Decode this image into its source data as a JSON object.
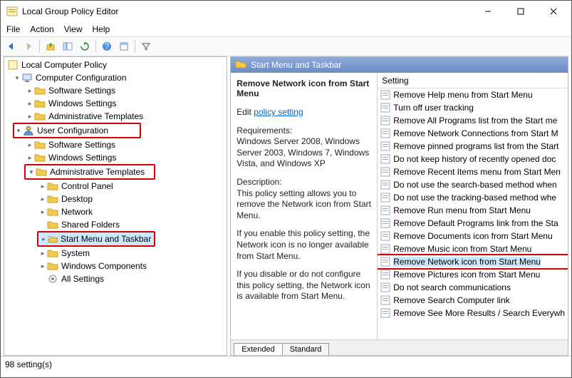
{
  "window": {
    "title": "Local Group Policy Editor"
  },
  "menu": {
    "file": "File",
    "action": "Action",
    "view": "View",
    "help": "Help"
  },
  "tree": {
    "root": "Local Computer Policy",
    "computer": "Computer Configuration",
    "cc_software": "Software Settings",
    "cc_windows": "Windows Settings",
    "cc_admin": "Administrative Templates",
    "user": "User Configuration",
    "uc_software": "Software Settings",
    "uc_windows": "Windows Settings",
    "uc_admin": "Administrative Templates",
    "control_panel": "Control Panel",
    "desktop": "Desktop",
    "network": "Network",
    "shared": "Shared Folders",
    "start": "Start Menu and Taskbar",
    "system": "System",
    "wincomp": "Windows Components",
    "allset": "All Settings"
  },
  "rp": {
    "header": "Start Menu and Taskbar",
    "title": "Remove Network icon from Start Menu",
    "edit_prefix": "Edit",
    "edit_link": "policy setting",
    "req_label": "Requirements:",
    "req_text": "Windows Server 2008, Windows Server 2003, Windows 7, Windows Vista, and Windows XP",
    "desc_label": "Description:",
    "desc_text": "This policy setting allows you to remove the Network icon from Start Menu.",
    "enable_text": "If you enable this policy setting, the Network icon is no longer available from Start Menu.",
    "disable_text": "If you disable or do not configure this policy setting, the Network icon is available from Start Menu."
  },
  "list": {
    "header": "Setting",
    "items": [
      "Remove Help menu from Start Menu",
      "Turn off user tracking",
      "Remove All Programs list from the Start me",
      "Remove Network Connections from Start M",
      "Remove pinned programs list from the Start",
      "Do not keep history of recently opened doc",
      "Remove Recent Items menu from Start Men",
      "Do not use the search-based method when",
      "Do not use the tracking-based method whe",
      "Remove Run menu from Start Menu",
      "Remove Default Programs link from the Sta",
      "Remove Documents icon from Start Menu",
      "Remove Music icon from Start Menu",
      "Remove Network icon from Start Menu",
      "Remove Pictures icon from Start Menu",
      "Do not search communications",
      "Remove Search Computer link",
      "Remove See More Results / Search Everywh"
    ]
  },
  "tabs": {
    "extended": "Extended",
    "standard": "Standard"
  },
  "status": "98 setting(s)"
}
